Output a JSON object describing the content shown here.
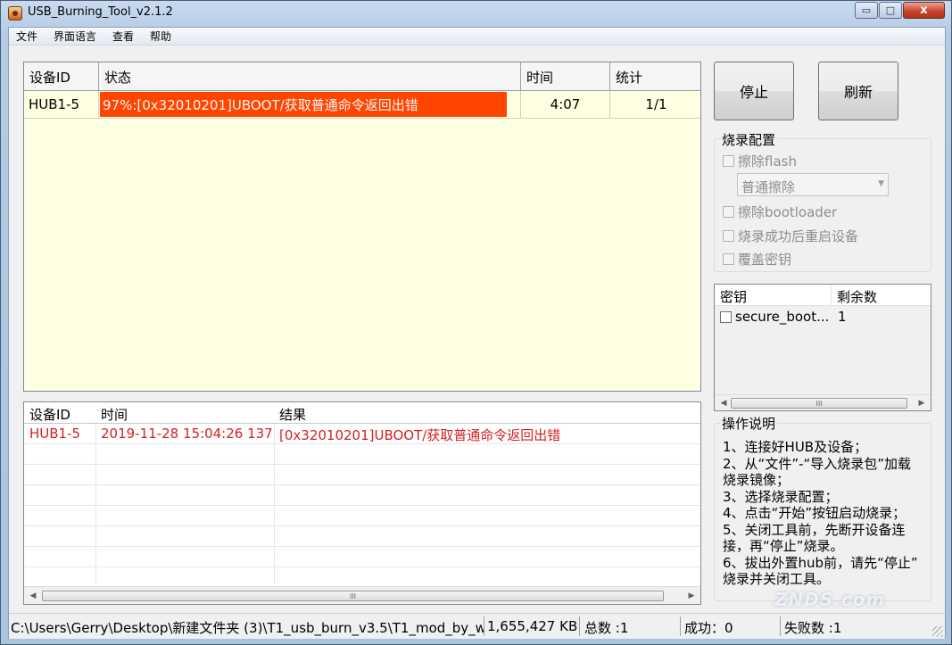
{
  "window": {
    "title": "USB_Burning_Tool_v2.1.2",
    "buttons": {
      "minimize": "▭",
      "maximize": "□",
      "close": "x"
    }
  },
  "menu": [
    "文件",
    "界面语言",
    "查看",
    "帮助"
  ],
  "device_grid": {
    "headers": [
      "设备ID",
      "状态",
      "时间",
      "统计"
    ],
    "rows": [
      {
        "device_id": "HUB1-5",
        "progress_percent": 97,
        "status": "97%:[0x32010201]UBOOT/获取普通命令返回出错",
        "time": "4:07",
        "stats": "1/1",
        "status_color": "#ff4500"
      }
    ]
  },
  "log_grid": {
    "headers": [
      "设备ID",
      "时间",
      "结果"
    ],
    "rows": [
      {
        "device_id": "HUB1-5",
        "time": "2019-11-28 15:04:26 137",
        "result": "[0x32010201]UBOOT/获取普通命令返回出错"
      }
    ],
    "text_color": "#d42020",
    "scroll_thumb_label": "III"
  },
  "actions": {
    "stop_label": "停止",
    "refresh_label": "刷新"
  },
  "burn_config": {
    "title": "烧录配置",
    "erase_flash": "擦除flash",
    "erase_mode": "普通擦除",
    "erase_bootloader": "擦除bootloader",
    "reboot_after": "烧录成功后重启设备",
    "overwrite_key": "覆盖密钥"
  },
  "keys_list": {
    "headers": [
      "密钥",
      "剩余数"
    ],
    "rows": [
      {
        "name": "secure_boot...",
        "remaining": "1"
      }
    ],
    "scroll_thumb_label": "III"
  },
  "instructions": {
    "title": "操作说明",
    "lines": [
      "1、连接好HUB及设备；",
      "2、从“文件”-“导入烧录包”加载",
      "烧录镜像；",
      "3、选择烧录配置；",
      "4、点击“开始”按钮启动烧录；",
      "5、关闭工具前，先断开设备连",
      "接，再“停止”烧录。",
      "6、拔出外置hub前，请先“停止”",
      "烧录并关闭工具。"
    ]
  },
  "statusbar": {
    "path": "C:\\Users\\Gerry\\Desktop\\新建文件夹 (3)\\T1_usb_burn_v3.5\\T1_mod_by_w",
    "size": "1,655,427 KB",
    "total": "总数 :1",
    "success": "成功：0",
    "fail": "失败数 :1"
  },
  "watermark": "ZNDS.com"
}
